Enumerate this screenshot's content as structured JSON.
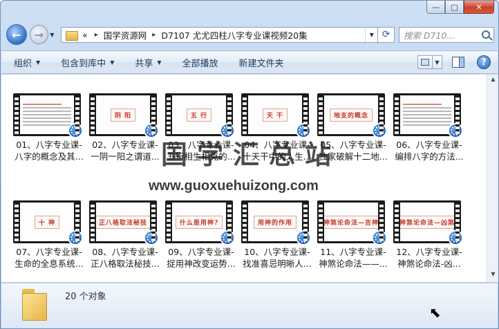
{
  "window": {
    "buttons": {
      "minimize": "—",
      "maximize": "□",
      "close": "✕"
    }
  },
  "address": {
    "overflow": "«",
    "crumbs": [
      "国学资源网",
      "D7107 尤尤四柱八字专业课视频20集"
    ],
    "separator": "▸",
    "search_placeholder": "搜索 D710..."
  },
  "toolbar": {
    "items": [
      {
        "label": "组织",
        "dropdown": true
      },
      {
        "label": "包含到库中",
        "dropdown": true
      },
      {
        "label": "共享",
        "dropdown": true
      },
      {
        "label": "全部播放",
        "dropdown": false
      },
      {
        "label": "新建文件夹",
        "dropdown": false
      }
    ],
    "help": "?"
  },
  "files": [
    {
      "line1": "01、八字专业课-",
      "line2": "八字的概念及其...",
      "thumb_text": "",
      "thumb_kind": "doc"
    },
    {
      "line1": "02、八字专业课-",
      "line2": "一阴一阳之谓道...",
      "thumb_text": "阴  阳",
      "thumb_kind": "title"
    },
    {
      "line1": "03、八字专业课-",
      "line2": "五行相生相克的...",
      "thumb_text": "五  行",
      "thumb_kind": "title"
    },
    {
      "line1": "04、八字专业课-",
      "line2": "十天干中的人生...",
      "thumb_text": "天  干",
      "thumb_kind": "title"
    },
    {
      "line1": "05、八字专业课-",
      "line2": "独家破解十二地...",
      "thumb_text": "地支的概念",
      "thumb_kind": "title"
    },
    {
      "line1": "06、八字专业课-",
      "line2": "编排八字的方法...",
      "thumb_text": "",
      "thumb_kind": "doc"
    },
    {
      "line1": "07、八字专业课-",
      "line2": "生命的全息系统...",
      "thumb_text": "十  神",
      "thumb_kind": "title"
    },
    {
      "line1": "08、八字专业课-",
      "line2": "正八格取法秘技...",
      "thumb_text": "正八格取法秘技",
      "thumb_kind": "title"
    },
    {
      "line1": "09、八字专业课-",
      "line2": "捉用神改变运势...",
      "thumb_text": "什么是用神?",
      "thumb_kind": "title"
    },
    {
      "line1": "10、八字专业课-",
      "line2": "找准喜忌明晰人...",
      "thumb_text": "用神的作用",
      "thumb_kind": "title"
    },
    {
      "line1": "11、八字专业课-",
      "line2": "神煞论命法——...",
      "thumb_text": "神煞论命法—吉神",
      "thumb_kind": "title"
    },
    {
      "line1": "12、八字专业课-",
      "line2": "神煞论命法-凶...",
      "thumb_text": "神煞论命法—凶煞",
      "thumb_kind": "title"
    }
  ],
  "watermark": {
    "title": "国学汇总站",
    "url": "www.guoxuehuizong.com"
  },
  "status": {
    "count": "20 个对象"
  }
}
